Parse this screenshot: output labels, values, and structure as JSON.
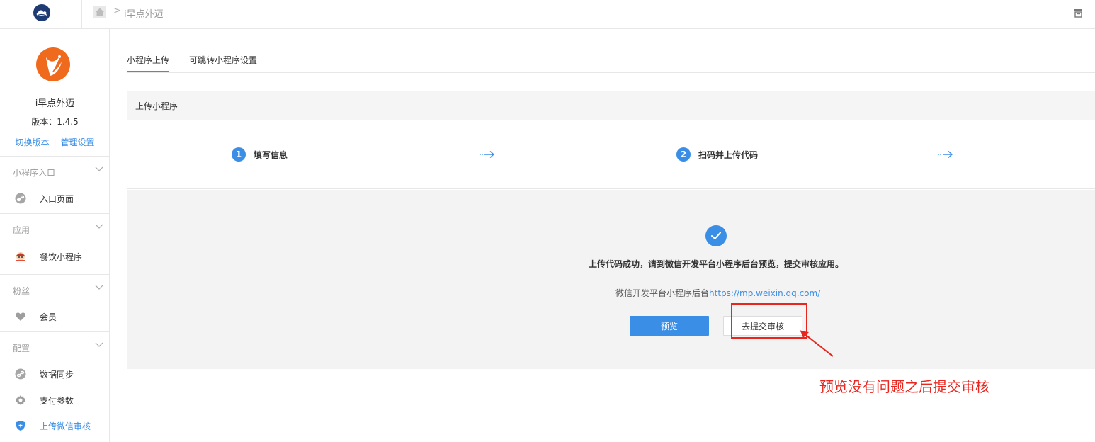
{
  "topbar": {
    "breadcrumb_sep": ">",
    "breadcrumb_current": "i早点外迈"
  },
  "sidebar": {
    "brand_name": "i早点外迈",
    "version": "版本：1.4.5",
    "switch_version": "切换版本",
    "link_sep": "|",
    "manage_settings": "管理设置",
    "groups": [
      {
        "title": "小程序入口",
        "items": [
          {
            "label": "入口页面",
            "icon": "link-icon"
          }
        ]
      },
      {
        "title": "应用",
        "items": [
          {
            "label": "餐饮小程序",
            "icon": "restaurant-icon"
          }
        ]
      },
      {
        "title": "粉丝",
        "items": [
          {
            "label": "会员",
            "icon": "heart-icon"
          }
        ]
      },
      {
        "title": "配置",
        "items": [
          {
            "label": "数据同步",
            "icon": "link-icon"
          },
          {
            "label": "支付参数",
            "icon": "gear-icon"
          },
          {
            "label": "上传微信审核",
            "icon": "shield-icon"
          }
        ]
      }
    ]
  },
  "tabs": [
    {
      "label": "小程序上传",
      "active": true
    },
    {
      "label": "可跳转小程序设置",
      "active": false
    }
  ],
  "panel": {
    "title": "上传小程序",
    "steps": [
      {
        "num": "1",
        "label": "填写信息"
      },
      {
        "num": "2",
        "label": "扫码并上传代码"
      }
    ],
    "arrow": "··→"
  },
  "result": {
    "title": "上传代码成功，请到微信开发平台小程序后台预览，提交审核应用。",
    "sub_prefix": "微信开发平台小程序后台",
    "sub_link": "https://mp.weixin.qq.com/",
    "preview_btn": "预览",
    "submit_btn": "去提交审核"
  },
  "annotation": {
    "text": "预览没有问题之后提交审核",
    "color": "#e8261f"
  },
  "colors": {
    "accent": "#3a8ee6",
    "brand_orange": "#ef6a1d"
  }
}
